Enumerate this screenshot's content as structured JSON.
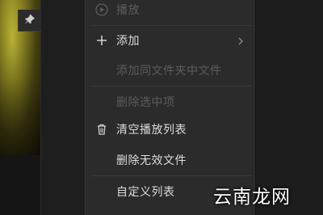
{
  "menu": {
    "items": [
      {
        "label": "播放",
        "icon": "play-circle-icon",
        "enabled": false
      },
      {
        "label": "添加",
        "icon": "plus-icon",
        "enabled": true,
        "submenu": true
      },
      {
        "label": "添加同文件夹中文件",
        "enabled": false
      },
      {
        "label": "删除选中项",
        "enabled": false
      },
      {
        "label": "清空播放列表",
        "icon": "trash-icon",
        "enabled": true
      },
      {
        "label": "删除无效文件",
        "enabled": true
      },
      {
        "label": "自定义列表",
        "enabled": true
      }
    ]
  },
  "overlay": {
    "pin_icon": "pin-icon"
  },
  "watermark": {
    "text": "云南龙网"
  },
  "colors": {
    "menu_bg": "#2b2b2b",
    "text_enabled": "#dcdcdc",
    "text_disabled": "#5c5c5c"
  }
}
